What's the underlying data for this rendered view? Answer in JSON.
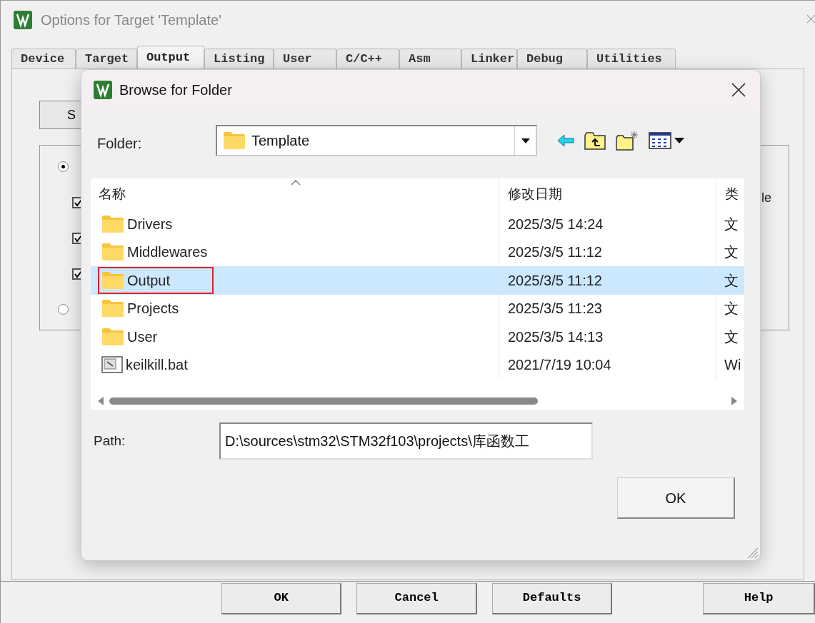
{
  "window": {
    "title": "Options for Target 'Template'",
    "tabs": [
      {
        "label": "Device",
        "selected": false
      },
      {
        "label": "Target",
        "selected": false
      },
      {
        "label": "Output",
        "selected": true
      },
      {
        "label": "Listing",
        "selected": false
      },
      {
        "label": "User",
        "selected": false
      },
      {
        "label": "C/C++",
        "selected": false
      },
      {
        "label": "Asm",
        "selected": false
      },
      {
        "label": "Linker",
        "selected": false
      },
      {
        "label": "Debug",
        "selected": false
      },
      {
        "label": "Utilities",
        "selected": false
      }
    ],
    "panel": {
      "button_1": "S",
      "text_1": "le",
      "options": [
        {
          "kind": "radio",
          "checked": true
        },
        {
          "kind": "checkbox",
          "checked": true
        },
        {
          "kind": "checkbox",
          "checked": true
        },
        {
          "kind": "checkbox",
          "checked": true
        },
        {
          "kind": "radio",
          "checked": false
        }
      ]
    },
    "buttons": [
      "OK",
      "Cancel",
      "Defaults",
      "Help"
    ]
  },
  "dialog": {
    "title": "Browse for Folder",
    "folder_label": "Folder:",
    "folder_value": "Template",
    "columns": [
      "名称",
      "修改日期",
      "类"
    ],
    "rows": [
      {
        "kind": "folder",
        "name": "Drivers",
        "date": "2025/3/5 14:24",
        "column_3": "文",
        "selected": false,
        "highlighted": false
      },
      {
        "kind": "folder",
        "name": "Middlewares",
        "date": "2025/3/5 11:12",
        "column_3": "文",
        "selected": false,
        "highlighted": false
      },
      {
        "kind": "folder",
        "name": "Output",
        "date": "2025/3/5 11:12",
        "column_3": "文",
        "selected": true,
        "highlighted": true
      },
      {
        "kind": "folder",
        "name": "Projects",
        "date": "2025/3/5 11:23",
        "column_3": "文",
        "selected": false,
        "highlighted": false
      },
      {
        "kind": "folder",
        "name": "User",
        "date": "2025/3/5 14:13",
        "column_3": "文",
        "selected": false,
        "highlighted": false
      },
      {
        "kind": "file",
        "name": "keilkill.bat",
        "date": "2021/7/19 10:04",
        "column_3": "Wi",
        "selected": false,
        "highlighted": false
      }
    ],
    "path_label": "Path:",
    "path_value": "D:\\sources\\stm32\\STM32f103\\projects\\库函数工",
    "ok": "OK"
  }
}
